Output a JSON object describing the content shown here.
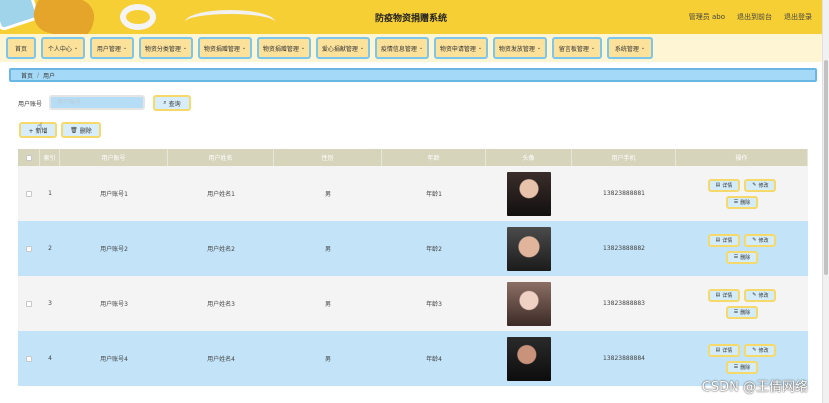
{
  "header": {
    "title": "防疫物资捐赠系统",
    "user_label": "管理员 abo",
    "back_label": "退出到前台",
    "logout_label": "退出登录"
  },
  "nav": {
    "items": [
      {
        "label": "首页",
        "caret": ""
      },
      {
        "label": "个人中心",
        "caret": "⌄"
      },
      {
        "label": "用户管理",
        "caret": "⌄"
      },
      {
        "label": "物资分类管理",
        "caret": "⌄"
      },
      {
        "label": "物资捐赠管理",
        "caret": "⌄"
      },
      {
        "label": "物资捐赠管理",
        "caret": "⌄"
      },
      {
        "label": "爱心捐献管理",
        "caret": "⌄"
      },
      {
        "label": "疫情信息管理",
        "caret": "⌄"
      },
      {
        "label": "物资申请管理",
        "caret": "⌄"
      },
      {
        "label": "物资发放管理",
        "caret": "⌄"
      },
      {
        "label": "留言板管理",
        "caret": "⌄"
      },
      {
        "label": "系统管理",
        "caret": "⌄"
      }
    ]
  },
  "breadcrumb": {
    "home": "首页",
    "sep": "/",
    "current": "用户"
  },
  "search": {
    "label": "用户账号",
    "placeholder": "用户账号",
    "button_label": "查询",
    "icon": "search-icon"
  },
  "actions": {
    "add_label": "+ 新增",
    "delete_label": "删除",
    "delete_icon": "trash-icon"
  },
  "table": {
    "headers": [
      "索引",
      "用户账号",
      "用户姓名",
      "性别",
      "年龄",
      "头像",
      "用户手机",
      "操作"
    ],
    "rows": [
      {
        "index": "1",
        "account": "用户账号1",
        "name": "用户姓名1",
        "gender": "男",
        "age": "年龄1",
        "phone": "13823888881",
        "avatar": "avatar-1"
      },
      {
        "index": "2",
        "account": "用户账号2",
        "name": "用户姓名2",
        "gender": "男",
        "age": "年龄2",
        "phone": "13823888882",
        "avatar": "avatar-2"
      },
      {
        "index": "3",
        "account": "用户账号3",
        "name": "用户姓名3",
        "gender": "男",
        "age": "年龄3",
        "phone": "13823888883",
        "avatar": "avatar-3"
      },
      {
        "index": "4",
        "account": "用户账号4",
        "name": "用户姓名4",
        "gender": "男",
        "age": "年龄4",
        "phone": "13823888884",
        "avatar": "avatar-4"
      }
    ],
    "ops": {
      "detail": "详情",
      "edit": "修改",
      "delete": "删除"
    }
  },
  "watermark": "CSDN @王倩网络",
  "colors": {
    "header": "#f6cf34",
    "nav_bg": "#fdf5d3",
    "nav_item": "#fbe19a",
    "accent_blue": "#a4daf7",
    "row_blue": "#c3e4f8",
    "table_head": "#d7d4bc"
  }
}
